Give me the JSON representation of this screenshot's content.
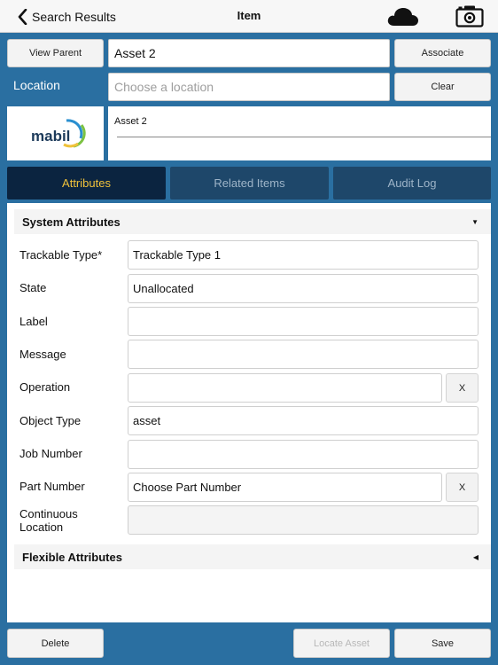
{
  "nav": {
    "back_label": "Search Results",
    "title": "Item"
  },
  "header": {
    "view_parent_label": "View Parent",
    "asset_name_value": "Asset 2",
    "associate_label": "Associate",
    "location_label": "Location",
    "location_placeholder": "Choose a location",
    "clear_label": "Clear",
    "logo_text": "mabil",
    "description_value": "Asset 2"
  },
  "tabs": [
    {
      "label": "Attributes",
      "active": true
    },
    {
      "label": "Related Items",
      "active": false
    },
    {
      "label": "Audit Log",
      "active": false
    }
  ],
  "system_attributes": {
    "title": "System Attributes",
    "expanded": true,
    "rows": [
      {
        "label": "Trackable Type*",
        "value": "Trackable Type 1"
      },
      {
        "label": "State",
        "value": "Unallocated"
      },
      {
        "label": "Label",
        "value": ""
      },
      {
        "label": "Message",
        "value": ""
      },
      {
        "label": "Operation",
        "value": "",
        "clear_label": "X"
      },
      {
        "label": "Object Type",
        "value": "asset"
      },
      {
        "label": "Job Number",
        "value": ""
      },
      {
        "label": "Part Number",
        "value": "",
        "placeholder": "Choose Part Number",
        "clear_label": "X"
      },
      {
        "label_line1": "Continuous",
        "label_line2": "Location",
        "value": ""
      }
    ]
  },
  "flexible_attributes": {
    "title": "Flexible Attributes",
    "expanded": false
  },
  "footer": {
    "delete_label": "Delete",
    "locate_asset_label": "Locate Asset",
    "save_label": "Save"
  },
  "colors": {
    "background": "#2a6fa1",
    "tab_active_text": "#f0c23b",
    "tab_active_bg": "#0b2440",
    "tab_inactive_bg": "#1e476a"
  },
  "icons": {
    "back": "chevron-left-icon",
    "cloud": "cloud-icon",
    "camera": "camera-icon",
    "section_expanded": "triangle-down-icon",
    "section_collapsed": "triangle-left-icon"
  }
}
